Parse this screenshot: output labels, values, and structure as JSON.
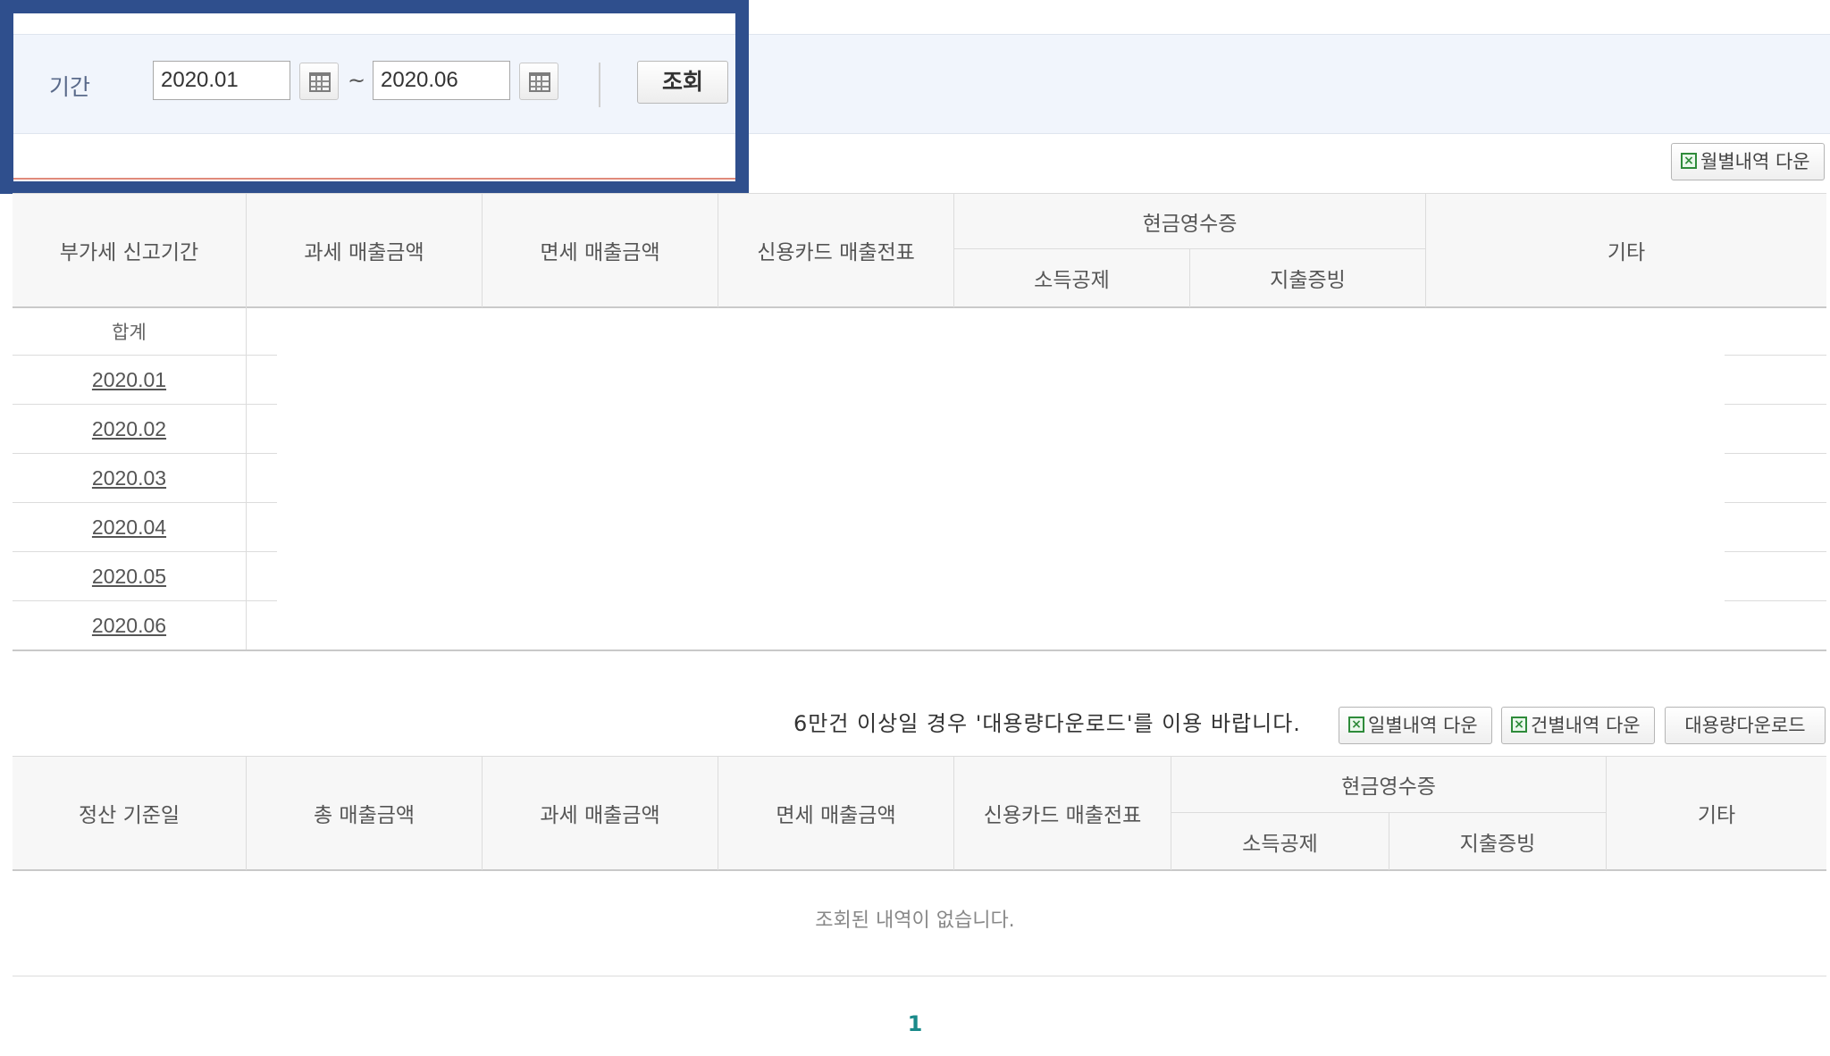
{
  "search": {
    "period_label": "기간",
    "start_value": "2020.01",
    "end_value": "2020.06",
    "separator": "~",
    "search_button": "조회"
  },
  "summary_table": {
    "download_monthly": "월별내역 다운",
    "headers": {
      "period": "부가세 신고기간",
      "taxable_sales": "과세 매출금액",
      "exempt_sales": "면세 매출금액",
      "card_sales": "신용카드 매출전표",
      "cash_receipt": "현금영수증",
      "income_deduction": "소득공제",
      "expense_proof": "지출증빙",
      "other": "기타"
    },
    "total_label": "합계",
    "rows": [
      "2020.01",
      "2020.02",
      "2020.03",
      "2020.04",
      "2020.05",
      "2020.06"
    ]
  },
  "detail_table": {
    "notice": "6만건 이상일 경우 '대용량다운로드'를 이용 바랍니다.",
    "download_daily": "일별내역 다운",
    "download_per_item": "건별내역 다운",
    "download_bulk": "대용량다운로드",
    "headers": {
      "settlement_date": "정산 기준일",
      "total_sales": "총 매출금액",
      "taxable_sales": "과세 매출금액",
      "exempt_sales": "면세 매출금액",
      "card_sales": "신용카드 매출전표",
      "cash_receipt": "현금영수증",
      "income_deduction": "소득공제",
      "expense_proof": "지출증빙",
      "other": "기타"
    },
    "empty_message": "조회된 내역이 없습니다."
  },
  "pagination": {
    "current_page": "1"
  },
  "colors": {
    "highlight_border": "#2f4f8d",
    "search_bg": "#f1f5fc",
    "page_accent": "#1a8a8a",
    "excel_green": "#2e8b3a"
  }
}
